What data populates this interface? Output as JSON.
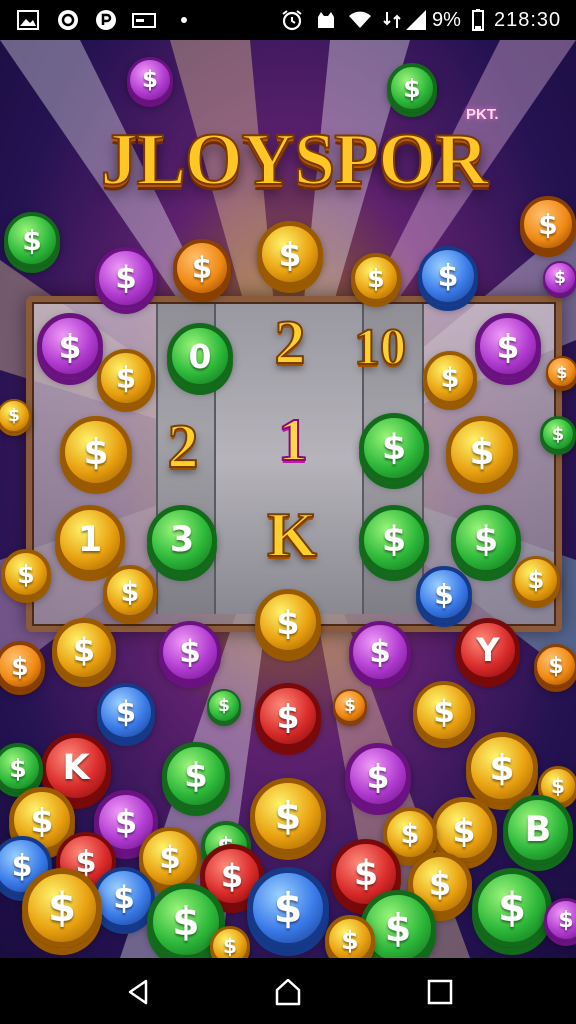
{
  "status_bar": {
    "battery": "9%",
    "time": "218:30",
    "icons": [
      "gallery-icon",
      "power-circle-icon",
      "parking-icon",
      "card-icon",
      "dot-icon",
      "alarm-icon",
      "cat-icon",
      "wifi-icon",
      "signal-icon",
      "battery-icon"
    ]
  },
  "game": {
    "logo_sub": "PKT.",
    "logo": "JLOYSPOR",
    "reel_symbols": {
      "top": [
        "0",
        "2",
        "10"
      ],
      "middle": [
        "2",
        "1"
      ],
      "bottom": [
        "1",
        "3",
        "K"
      ]
    },
    "coin_labels": {
      "dollar": "$",
      "k": "K",
      "y": "Y",
      "b": "B"
    }
  },
  "nav_bar": {
    "icons": [
      "back-icon",
      "home-icon",
      "recents-icon"
    ]
  },
  "colors": {
    "gold": "#ffc626",
    "purple": "#b03ad0",
    "green": "#2db83a",
    "red": "#d92a2a",
    "blue": "#3a7ae8",
    "orange": "#f08a14",
    "frame": "#8a5a3a"
  }
}
